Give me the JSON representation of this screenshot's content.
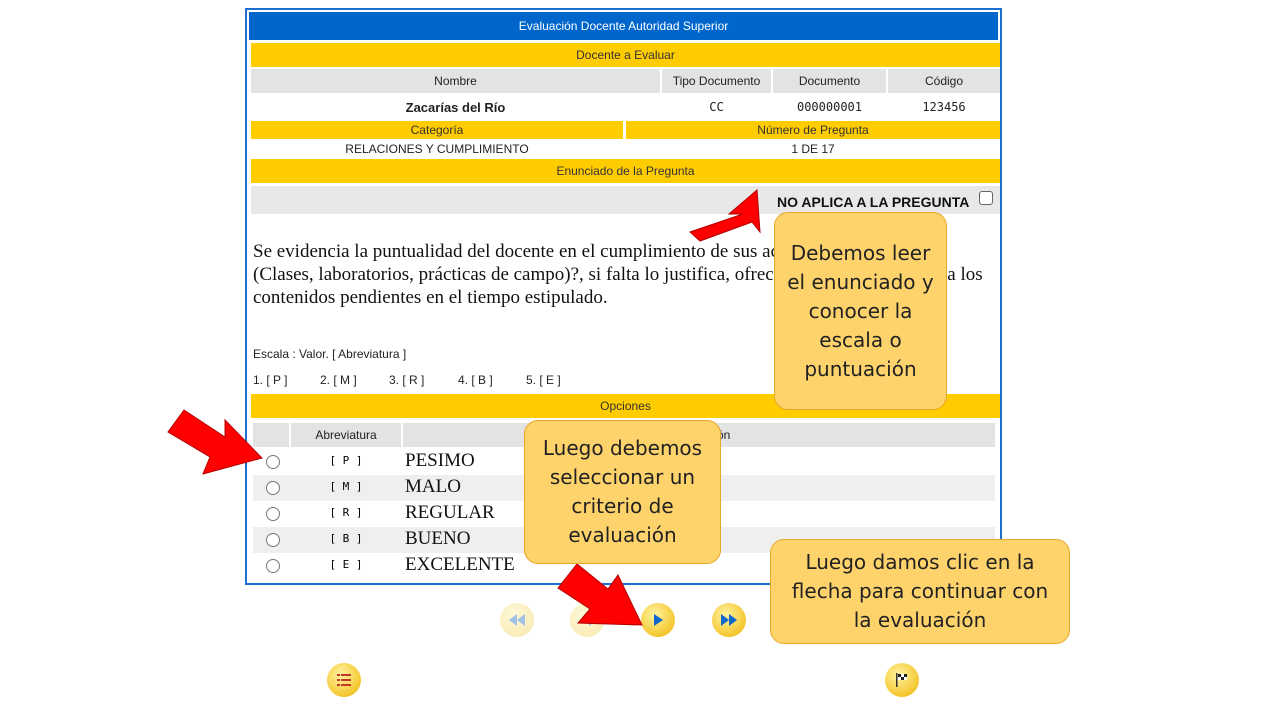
{
  "form": {
    "title": "Evaluación Docente Autoridad Superior",
    "teacher_section": "Docente a Evaluar",
    "headers": {
      "name": "Nombre",
      "doc_type": "Tipo Documento",
      "document": "Documento",
      "code": "Código"
    },
    "teacher": {
      "name": "Zacarías del Río",
      "doc_type": "CC",
      "document": "000000001",
      "code": "123456"
    },
    "category_label": "Categoría",
    "question_number_label": "Número de Pregunta",
    "category": "RELACIONES Y CUMPLIMIENTO",
    "question_number": "1 DE 17",
    "statement_label": "Enunciado de la Pregunta",
    "not_applicable_label": "NO APLICA A LA PREGUNTA",
    "question_text": "Se evidencia la puntualidad del docente en el cumplimiento de sus actividades académicas (Clases, laboratorios, prácticas de campo)?, si falta lo justifica, ofrece soluciones y completa los contenidos pendientes en el tiempo estipulado.",
    "scale_label": "Escala : Valor. [ Abreviatura ]",
    "scale": [
      "1. [ P ]",
      "2. [ M ]",
      "3. [ R ]",
      "4. [ B ]",
      "5. [ E ]"
    ],
    "options_label": "Opciones",
    "options_headers": {
      "abbr": "Abreviatura",
      "description": "Descripción"
    },
    "options": [
      {
        "abbr": "[ P ]",
        "label": "PESIMO"
      },
      {
        "abbr": "[ M ]",
        "label": "MALO"
      },
      {
        "abbr": "[ R ]",
        "label": "REGULAR"
      },
      {
        "abbr": "[ B ]",
        "label": "BUENO"
      },
      {
        "abbr": "[ E ]",
        "label": "EXCELENTE"
      }
    ]
  },
  "callouts": {
    "read": "Debemos leer el enunciado y conocer la escala o puntuación",
    "select": "Luego debemos seleccionar un criterio de evaluación",
    "next": "Luego damos clic en la flecha para continuar con la evaluación"
  },
  "icons": {
    "first": "first-page-icon",
    "prev": "previous-icon",
    "next": "next-icon",
    "last": "last-page-icon",
    "list": "list-icon",
    "finish": "finish-flag-icon"
  },
  "colors": {
    "header_blue": "#0066cc",
    "section_yellow": "#ffcc00",
    "callout": "#ffd36b",
    "arrow_red": "#ff0000"
  }
}
